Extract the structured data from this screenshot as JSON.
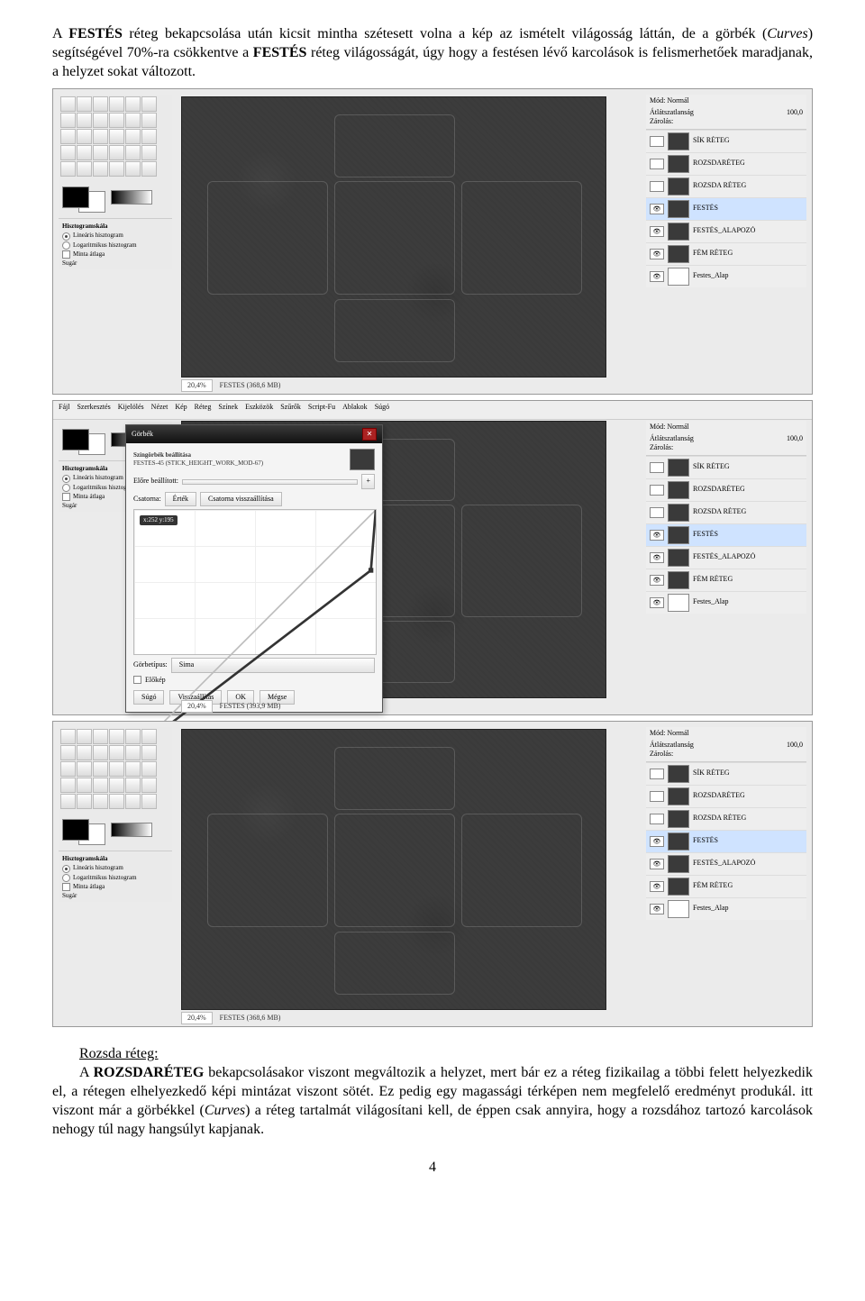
{
  "para1_parts": {
    "t1": "A ",
    "b1": "FESTÉS",
    "t2": " réteg bekapcsolása után kicsit mintha szétesett volna a kép az ismételt világosság láttán, de a görbék (",
    "i1": "Curves",
    "t3": ") segítségével 70%-ra csökkentve a ",
    "b2": "FESTÉS",
    "t4": " réteg világosságát, úgy hogy a festésen lévő karcolások is felismerhetőek maradjanak, a helyzet sokat változott."
  },
  "subhead1": "Rozsda réteg:",
  "para2_parts": {
    "t1": "A ",
    "b1": "ROZSDARÉTEG",
    "t2": " bekapcsolásakor viszont megváltozik a helyzet, mert bár ez a réteg fizikailag a többi felett helyezkedik el, a rétegen elhelyezkedő képi mintázat viszont sötét. Ez pedig egy magassági térképen nem megfelelő eredményt produkál. itt viszont már a görbékkel (",
    "i1": "Curves",
    "t3": ") a réteg tartalmát világosítani kell, de éppen csak annyira, hogy a rozsdához tartozó karcolások nehogy túl nagy hangsúlyt kapjanak."
  },
  "pagenum": "4",
  "shot_common": {
    "mode_label": "Mód:",
    "mode_value": "Normál",
    "opacity_label": "Átlátszatlanság",
    "opacity_value": "100,0",
    "lock_label": "Zárolás:",
    "histo_label": "Hisztogramskála",
    "histo_opt1": "Lineáris hisztogram",
    "histo_opt2": "Logaritmikus hisztogram",
    "avg_label": "Minta átlaga",
    "sugar_label": "Sugár"
  },
  "layers": [
    {
      "name": "SÍK RÉTEG"
    },
    {
      "name": "ROZSDARÉTEG"
    },
    {
      "name": "ROZSDA RÉTEG"
    },
    {
      "name": "FESTÉS"
    },
    {
      "name": "FESTÉS_ALAPOZÓ"
    },
    {
      "name": "FÉM RÉTEG"
    },
    {
      "name": "Festes_Alap"
    }
  ],
  "shot1": {
    "zoom": "20,4%",
    "status_file": "FESTES (368,6 MB)",
    "selected_layer_index": 3
  },
  "shot2": {
    "menubar": [
      "Fájl",
      "Szerkesztés",
      "Kijelölés",
      "Nézet",
      "Kép",
      "Réteg",
      "Színek",
      "Eszközök",
      "Szűrők",
      "Script-Fu",
      "Ablakok",
      "Súgó"
    ],
    "zoom": "20,4%",
    "status_file": "FESTES (393,9 MB)",
    "selected_layer_index": 3,
    "dialog": {
      "title": "Görbék",
      "subtitle1": "Színgörbék beállítása",
      "subtitle2": "FESTES-45 (STICK_HEIGHT_WORK_MOD-67)",
      "preset_label": "Előre beállított:",
      "channel_label": "Csatorna:",
      "channel_value": "Érték",
      "reset_channel": "Csatorna visszaállítása",
      "tooltip": "x:252 y:195",
      "curve_type_label": "Görbetípus:",
      "curve_type_value": "Sima",
      "preview_label": "Előkép",
      "btn_help": "Súgó",
      "btn_reset": "Visszaállítás",
      "btn_ok": "OK",
      "btn_cancel": "Mégse"
    }
  },
  "shot3": {
    "zoom": "20,4%",
    "status_file": "FESTES (368,6 MB)",
    "selected_layer_index": 3
  }
}
